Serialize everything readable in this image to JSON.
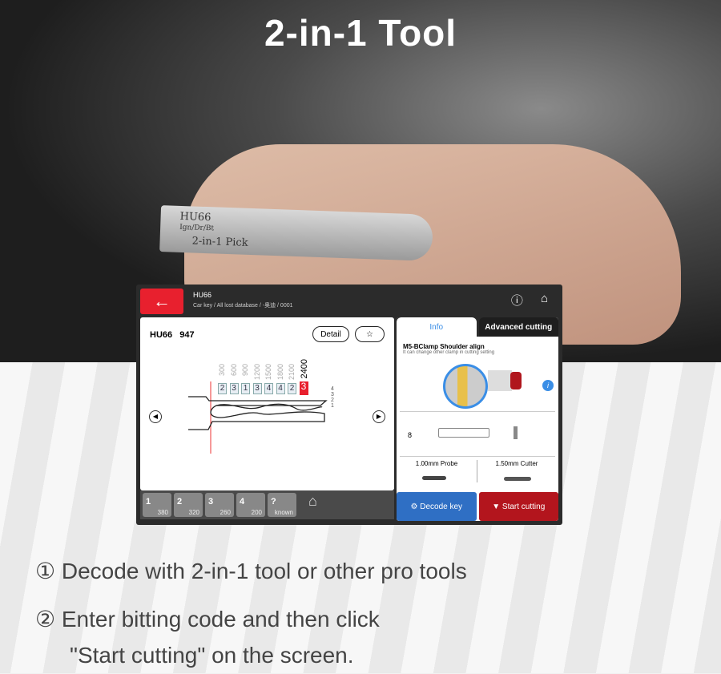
{
  "headline": "2-in-1 Tool",
  "pick_engraving": {
    "model": "HU66",
    "sub": "Ign/Dr/Bt",
    "label": "2-in-1 Pick"
  },
  "app": {
    "header": {
      "title": "HU66",
      "breadcrumb": "Car key / All lost database / -奥迪 / 0001"
    },
    "key_panel": {
      "key_name": "HU66",
      "key_number": "947",
      "detail_label": "Detail",
      "depths": [
        "300",
        "600",
        "900",
        "1200",
        "1500",
        "1800",
        "2100",
        "2400"
      ],
      "cuts": [
        "2",
        "3",
        "1",
        "3",
        "4",
        "4",
        "2",
        "3"
      ],
      "active_cut_index": 7,
      "levels": [
        "4",
        "3",
        "2",
        "1"
      ]
    },
    "cut_keys": [
      {
        "pos": "1",
        "val": "380"
      },
      {
        "pos": "2",
        "val": "320"
      },
      {
        "pos": "3",
        "val": "260"
      },
      {
        "pos": "4",
        "val": "200"
      },
      {
        "pos": "?",
        "val": "known"
      }
    ],
    "tabs": {
      "info": "Info",
      "advanced": "Advanced cutting"
    },
    "info": {
      "clamp": "M5-BClamp Shoulder align",
      "clamp_note": "It can change other clamp in cutting setting",
      "position": "8",
      "probe": "1.00mm Probe",
      "cutter": "1.50mm Cutter"
    },
    "actions": {
      "decode": "Decode key",
      "start": "Start cutting"
    },
    "colors": {
      "accent_red": "#e8202e",
      "decode_blue": "#2f6fc4",
      "start_red": "#b3151d",
      "info_blue": "#3a8ee6"
    }
  },
  "steps": [
    "① Decode with 2-in-1 tool or other pro tools",
    "② Enter bitting code and then click",
    "\"Start cutting\" on the screen."
  ]
}
